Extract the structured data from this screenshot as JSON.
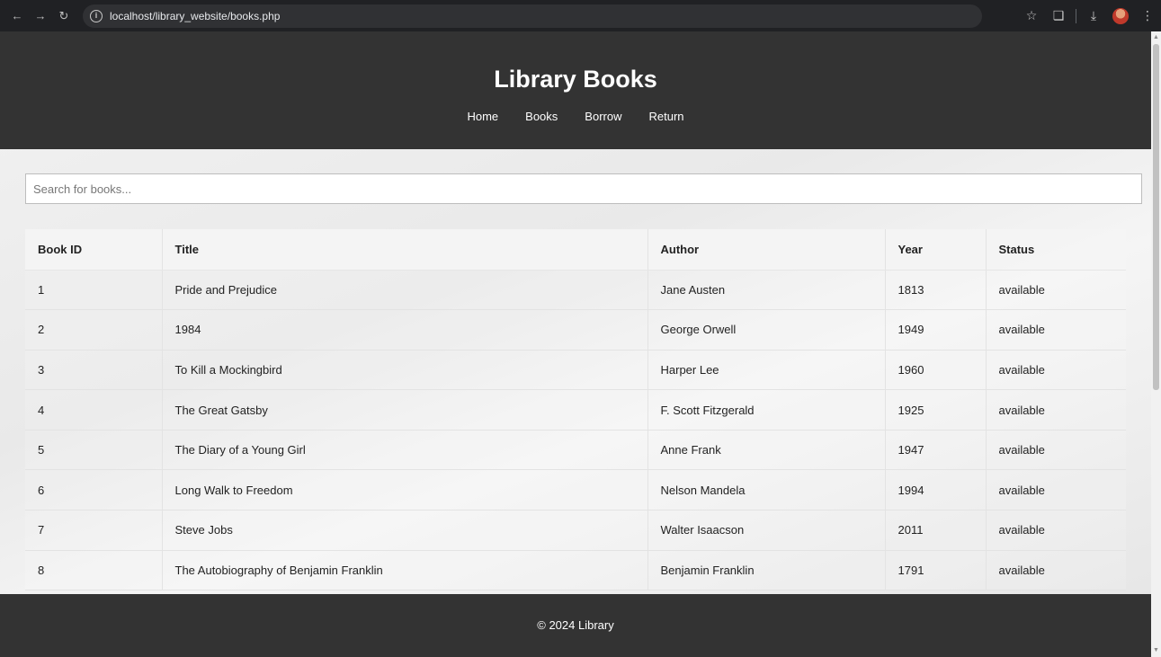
{
  "browser": {
    "url": "localhost/library_website/books.php",
    "icons": [
      "back-arrow-icon",
      "forward-arrow-icon",
      "reload-icon",
      "info-icon",
      "star-icon",
      "extensions-icon",
      "download-icon",
      "profile-avatar",
      "kebab-menu-icon"
    ]
  },
  "header": {
    "title": "Library Books",
    "nav": [
      "Home",
      "Books",
      "Borrow",
      "Return"
    ]
  },
  "search": {
    "placeholder": "Search for books...",
    "value": ""
  },
  "table": {
    "columns": [
      "Book ID",
      "Title",
      "Author",
      "Year",
      "Status"
    ],
    "rows": [
      [
        "1",
        "Pride and Prejudice",
        "Jane Austen",
        "1813",
        "available"
      ],
      [
        "2",
        "1984",
        "George Orwell",
        "1949",
        "available"
      ],
      [
        "3",
        "To Kill a Mockingbird",
        "Harper Lee",
        "1960",
        "available"
      ],
      [
        "4",
        "The Great Gatsby",
        "F. Scott Fitzgerald",
        "1925",
        "available"
      ],
      [
        "5",
        "The Diary of a Young Girl",
        "Anne Frank",
        "1947",
        "available"
      ],
      [
        "6",
        "Long Walk to Freedom",
        "Nelson Mandela",
        "1994",
        "available"
      ],
      [
        "7",
        "Steve Jobs",
        "Walter Isaacson",
        "2011",
        "available"
      ],
      [
        "8",
        "The Autobiography of Benjamin Franklin",
        "Benjamin Franklin",
        "1791",
        "available"
      ]
    ]
  },
  "footer": {
    "text": "© 2024 Library"
  },
  "colors": {
    "header_bg": "#333333",
    "footer_bg": "#333333",
    "chrome_bg": "#202124"
  }
}
